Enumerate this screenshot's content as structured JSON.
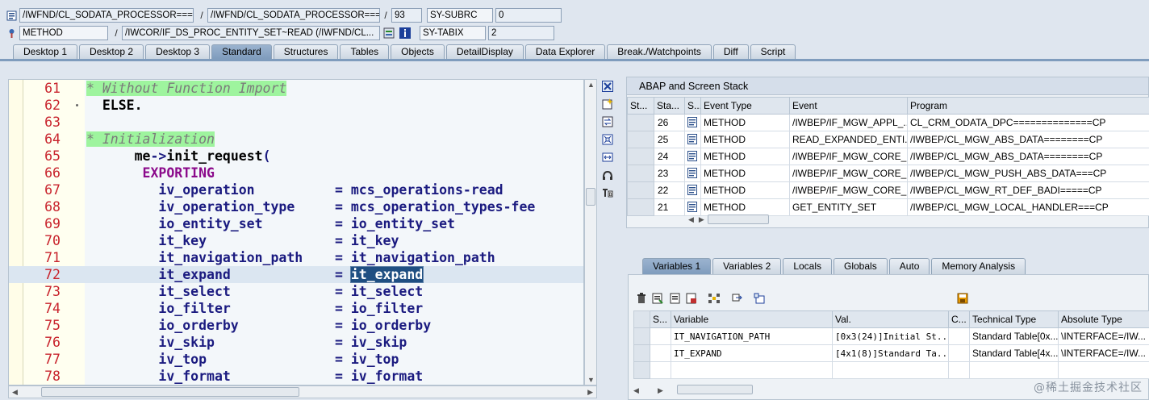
{
  "header": {
    "row1": {
      "program": "/IWFND/CL_SODATA_PROCESSOR===...",
      "include": "/IWFND/CL_SODATA_PROCESSOR===...",
      "line": "93",
      "sysvar_name": "SY-SUBRC",
      "sysvar_value": "0",
      "sep": "/"
    },
    "row2": {
      "type": "METHOD",
      "method": "/IWCOR/IF_DS_PROC_ENTITY_SET~READ (/IWFND/CL...",
      "sysvar_name": "SY-TABIX",
      "sysvar_value": "2",
      "sep": "/"
    }
  },
  "tabs_top": [
    "Desktop 1",
    "Desktop 2",
    "Desktop 3",
    "Standard",
    "Structures",
    "Tables",
    "Objects",
    "DetailDisplay",
    "Data Explorer",
    "Break./Watchpoints",
    "Diff",
    "Script"
  ],
  "active_top_tab": "Standard",
  "code": {
    "lines": [
      {
        "no": "61",
        "parts": [
          {
            "t": "* Without Function Import",
            "c": "comment"
          }
        ]
      },
      {
        "no": "62",
        "parts": [
          {
            "t": "  ",
            "c": ""
          },
          {
            "t": "ELSE.",
            "c": "kw"
          }
        ],
        "dot": true
      },
      {
        "no": "63",
        "parts": []
      },
      {
        "no": "64",
        "parts": [
          {
            "t": "* Initialization",
            "c": "comment"
          }
        ]
      },
      {
        "no": "65",
        "parts": [
          {
            "t": "      me",
            "c": "kw"
          },
          {
            "t": "->",
            "c": "op"
          },
          {
            "t": "init_request",
            "c": "kw"
          },
          {
            "t": "(",
            "c": "op"
          }
        ]
      },
      {
        "no": "66",
        "parts": [
          {
            "t": "       EXPORTING",
            "c": "kw2"
          }
        ]
      },
      {
        "no": "67",
        "parts": [
          {
            "t": "         iv_operation          ",
            "c": ""
          },
          {
            "t": "=",
            "c": "op"
          },
          {
            "t": " mcs_operations",
            "c": ""
          },
          {
            "t": "-",
            "c": "op"
          },
          {
            "t": "read",
            "c": ""
          }
        ]
      },
      {
        "no": "68",
        "parts": [
          {
            "t": "         iv_operation_type     ",
            "c": ""
          },
          {
            "t": "=",
            "c": "op"
          },
          {
            "t": " mcs_operation_types",
            "c": ""
          },
          {
            "t": "-",
            "c": "op"
          },
          {
            "t": "fee",
            "c": ""
          }
        ]
      },
      {
        "no": "69",
        "parts": [
          {
            "t": "         io_entity_set         ",
            "c": ""
          },
          {
            "t": "=",
            "c": "op"
          },
          {
            "t": " io_entity_set",
            "c": ""
          }
        ]
      },
      {
        "no": "70",
        "parts": [
          {
            "t": "         it_key                ",
            "c": ""
          },
          {
            "t": "=",
            "c": "op"
          },
          {
            "t": " it_key",
            "c": ""
          }
        ]
      },
      {
        "no": "71",
        "parts": [
          {
            "t": "         it_navigation_path    ",
            "c": ""
          },
          {
            "t": "=",
            "c": "op"
          },
          {
            "t": " it_navigation_path",
            "c": ""
          }
        ]
      },
      {
        "no": "72",
        "parts": [
          {
            "t": "         it_expand             ",
            "c": ""
          },
          {
            "t": "=",
            "c": "op"
          },
          {
            "t": " ",
            "c": ""
          },
          {
            "t": "it_expand",
            "c": "sel"
          }
        ],
        "current": true
      },
      {
        "no": "73",
        "parts": [
          {
            "t": "         it_select             ",
            "c": ""
          },
          {
            "t": "=",
            "c": "op"
          },
          {
            "t": " it_select",
            "c": ""
          }
        ]
      },
      {
        "no": "74",
        "parts": [
          {
            "t": "         io_filter             ",
            "c": ""
          },
          {
            "t": "=",
            "c": "op"
          },
          {
            "t": " io_filter",
            "c": ""
          }
        ]
      },
      {
        "no": "75",
        "parts": [
          {
            "t": "         io_orderby            ",
            "c": ""
          },
          {
            "t": "=",
            "c": "op"
          },
          {
            "t": " io_orderby",
            "c": ""
          }
        ]
      },
      {
        "no": "76",
        "parts": [
          {
            "t": "         iv_skip               ",
            "c": ""
          },
          {
            "t": "=",
            "c": "op"
          },
          {
            "t": " iv_skip",
            "c": ""
          }
        ]
      },
      {
        "no": "77",
        "parts": [
          {
            "t": "         iv_top                ",
            "c": ""
          },
          {
            "t": "=",
            "c": "op"
          },
          {
            "t": " iv_top",
            "c": ""
          }
        ]
      },
      {
        "no": "78",
        "parts": [
          {
            "t": "         iv_format             ",
            "c": ""
          },
          {
            "t": "=",
            "c": "op"
          },
          {
            "t": " iv_format",
            "c": ""
          }
        ]
      }
    ]
  },
  "stack": {
    "title": "ABAP and Screen Stack",
    "columns": [
      "St...",
      "Sta...",
      "S...",
      "Event Type",
      "Event",
      "Program"
    ],
    "rows": [
      {
        "sta": "26",
        "type": "METHOD",
        "event": "/IWBEP/IF_MGW_APPL_...",
        "program": "CL_CRM_ODATA_DPC==============CP"
      },
      {
        "sta": "25",
        "type": "METHOD",
        "event": "READ_EXPANDED_ENTI...",
        "program": "/IWBEP/CL_MGW_ABS_DATA========CP"
      },
      {
        "sta": "24",
        "type": "METHOD",
        "event": "/IWBEP/IF_MGW_CORE_...",
        "program": "/IWBEP/CL_MGW_ABS_DATA========CP"
      },
      {
        "sta": "23",
        "type": "METHOD",
        "event": "/IWBEP/IF_MGW_CORE_...",
        "program": "/IWBEP/CL_MGW_PUSH_ABS_DATA===CP"
      },
      {
        "sta": "22",
        "type": "METHOD",
        "event": "/IWBEP/IF_MGW_CORE_...",
        "program": "/IWBEP/CL_MGW_RT_DEF_BADI=====CP"
      },
      {
        "sta": "21",
        "type": "METHOD",
        "event": "GET_ENTITY_SET",
        "program": "/IWBEP/CL_MGW_LOCAL_HANDLER===CP"
      }
    ]
  },
  "var_tabs": [
    "Variables 1",
    "Variables 2",
    "Locals",
    "Globals",
    "Auto",
    "Memory Analysis"
  ],
  "active_var_tab": "Variables 1",
  "variables": {
    "columns": [
      "S...",
      "Variable",
      "Val.",
      "C...",
      "Technical Type",
      "Absolute Type"
    ],
    "rows": [
      {
        "variable": "IT_NAVIGATION_PATH",
        "value": "[0x3(24)]Initial St...",
        "tech": "Standard Table[0x...",
        "abs": "\\INTERFACE=/IW..."
      },
      {
        "variable": "IT_EXPAND",
        "value": "[4x1(8)]Standard Ta...",
        "tech": "Standard Table[4x...",
        "abs": "\\INTERFACE=/IW..."
      }
    ]
  },
  "watermark": "@稀土掘金技术社区",
  "colors": {
    "active_tab": "#7f9cbd",
    "line_numbers": "#c8232c",
    "comment_bg": "#9ef49e",
    "selection": "#1f4f82"
  }
}
